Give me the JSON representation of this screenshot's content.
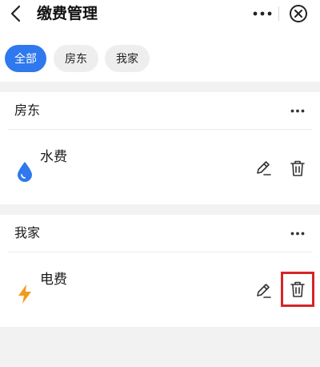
{
  "header": {
    "title": "缴费管理",
    "back_icon": "chevron-left-icon",
    "more_icon": "more-horizontal-icon",
    "close_icon": "close-circle-icon"
  },
  "filters": {
    "selected": "全部",
    "items": [
      {
        "label": "全部"
      },
      {
        "label": "房东"
      },
      {
        "label": "我家"
      }
    ]
  },
  "groups": [
    {
      "title": "房东",
      "more_icon": "more-horizontal-icon",
      "bills": [
        {
          "name": "水费",
          "icon": "water-drop-icon",
          "icon_color": "#2f78ee"
        }
      ]
    },
    {
      "title": "我家",
      "more_icon": "more-horizontal-icon",
      "bills": [
        {
          "name": "电费",
          "icon": "lightning-icon",
          "icon_color": "#f39a1e"
        }
      ]
    }
  ],
  "colors": {
    "accent": "#2f78ee",
    "highlight_border": "#d4262a",
    "background": "#f2f2f2"
  }
}
